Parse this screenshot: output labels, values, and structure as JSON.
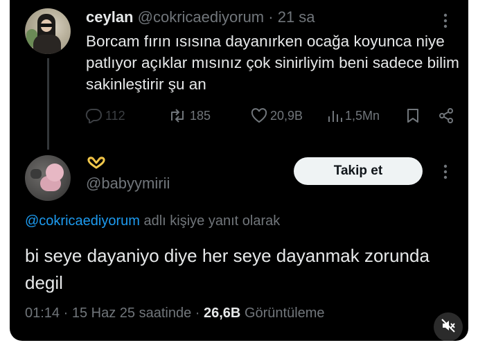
{
  "tweet": {
    "display_name": "ceylan",
    "handle": "@cokricaediyorum",
    "separator": "·",
    "time": "21 sa",
    "text": "Borcam fırın ısısına dayanırken ocağa koyunca niye patlıyor açıklar mısınız çok sinirliyim beni sadece bilim sakinleştirir şu an",
    "actions": {
      "replies": "112",
      "retweets": "185",
      "likes": "20,9B",
      "views": "1,5Mn"
    },
    "icons": [
      "reply-icon",
      "retweet-icon",
      "like-icon",
      "views-icon",
      "bookmark-icon",
      "share-icon",
      "more-icon"
    ]
  },
  "reply": {
    "display_name_emoji": "heart-hands-emoji",
    "handle": "@babyymirii",
    "follow_label": "Takip et",
    "replying_to_handle": "@cokricaediyorum",
    "replying_to_suffix": " adlı kişiye yanıt olarak",
    "text": "bi seye dayaniyo diye her seye dayanmak zorunda degil",
    "time": "01:14",
    "date": "15 Haz 25 saatinde",
    "views_count": "26,6B",
    "views_label": "Görüntüleme",
    "sep": "·"
  },
  "colors": {
    "background": "#000000",
    "text_primary": "#e7e9ea",
    "text_secondary": "#71767b",
    "link": "#1d9bf0",
    "button_bg": "#eff3f4"
  }
}
